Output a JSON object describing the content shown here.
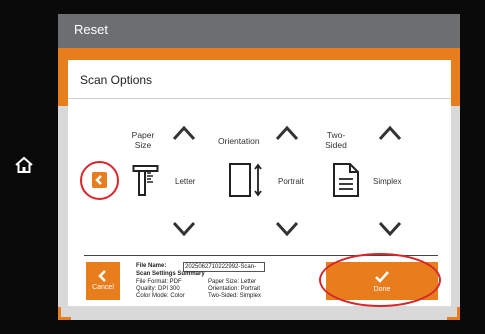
{
  "topbar": {
    "reset_label": "Reset"
  },
  "dialog": {
    "title": "Scan Options"
  },
  "options": {
    "paper_size": {
      "label_line1": "Paper",
      "label_line2": "Size",
      "value": "Letter"
    },
    "orientation": {
      "label": "Orientation",
      "value": "Portrait"
    },
    "two_sided": {
      "label_line1": "Two-",
      "label_line2": "Sided",
      "value": "Simplex"
    }
  },
  "summary": {
    "file_name_label": "File Name:",
    "file_name_value": "20250627102229​92-Scan-",
    "heading": "Scan Settings Summary",
    "file_format": "File Format: PDF",
    "quality": "Quality: DPI 300",
    "color_mode": "Color Mode: Color",
    "paper_size": "Paper Size: Letter",
    "orientation": "Orientation: Portrait",
    "two_sided": "Two-Sided: Simplex"
  },
  "buttons": {
    "cancel_label": "Cancel",
    "done_label": "Done"
  },
  "colors": {
    "accent": "#e87d1e",
    "annotation": "#d9262b",
    "topbar": "#6d6e70"
  },
  "icons": [
    "home-icon",
    "chevron-left-icon",
    "chevron-up-icon",
    "chevron-down-icon",
    "paper-size-icon",
    "orientation-icon",
    "document-icon",
    "checkmark-icon"
  ]
}
